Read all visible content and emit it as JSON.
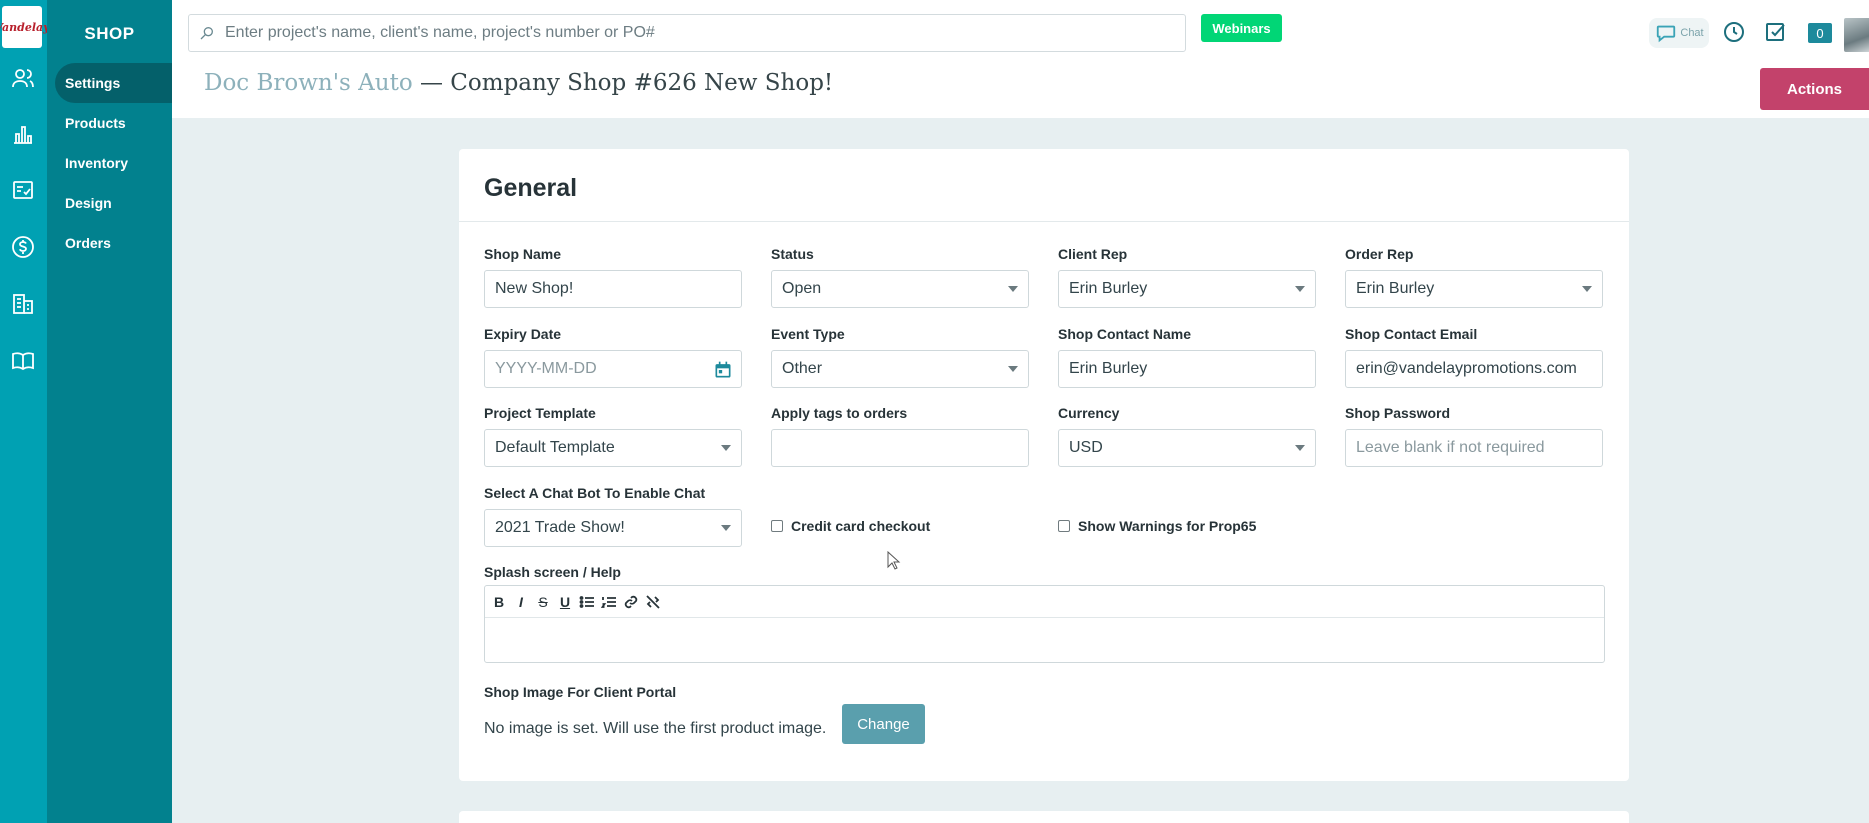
{
  "rail": {
    "logo_text": "Vandelay",
    "icons": [
      "users-icon",
      "bar-chart-icon",
      "tasks-icon",
      "dollar-icon",
      "building-icon",
      "book-icon"
    ]
  },
  "subnav": {
    "title": "SHOP",
    "items": [
      {
        "label": "Settings",
        "active": true
      },
      {
        "label": "Products"
      },
      {
        "label": "Inventory"
      },
      {
        "label": "Design"
      },
      {
        "label": "Orders"
      }
    ]
  },
  "header": {
    "search_placeholder": "Enter project's name, client's name, project's number or PO#",
    "webinars_label": "Webinars",
    "chat_label": "Chat",
    "notification_count": "0",
    "breadcrumb_client": "Doc Brown's Auto",
    "breadcrumb_rest": " — Company Shop #626 New Shop!",
    "actions_label": "Actions"
  },
  "general": {
    "title": "General",
    "shop_name": {
      "label": "Shop Name",
      "value": "New Shop!"
    },
    "status": {
      "label": "Status",
      "value": "Open"
    },
    "client_rep": {
      "label": "Client Rep",
      "value": "Erin Burley"
    },
    "order_rep": {
      "label": "Order Rep",
      "value": "Erin Burley"
    },
    "expiry_date": {
      "label": "Expiry Date",
      "placeholder": "YYYY-MM-DD"
    },
    "event_type": {
      "label": "Event Type",
      "value": "Other"
    },
    "shop_contact_name": {
      "label": "Shop Contact Name",
      "value": "Erin Burley"
    },
    "shop_contact_email": {
      "label": "Shop Contact Email",
      "value": "erin@vandelaypromotions.com"
    },
    "project_template": {
      "label": "Project Template",
      "value": "Default Template"
    },
    "apply_tags": {
      "label": "Apply tags to orders",
      "value": ""
    },
    "currency": {
      "label": "Currency",
      "value": "USD"
    },
    "shop_password": {
      "label": "Shop Password",
      "placeholder": "Leave blank if not required"
    },
    "chat_bot": {
      "label": "Select A Chat Bot To Enable Chat",
      "value": "2021 Trade Show!"
    },
    "credit_card_checkout": {
      "label": "Credit card checkout",
      "checked": false
    },
    "prop65": {
      "label": "Show Warnings for Prop65",
      "checked": false
    },
    "splash": {
      "label": "Splash screen / Help",
      "toolbar": [
        "B",
        "I",
        "S",
        "U",
        "bulleted-list",
        "numbered-list",
        "link",
        "unlink"
      ]
    },
    "shop_image": {
      "label": "Shop Image For Client Portal",
      "note": "No image is set. Will use the first product image.",
      "change_label": "Change"
    }
  }
}
